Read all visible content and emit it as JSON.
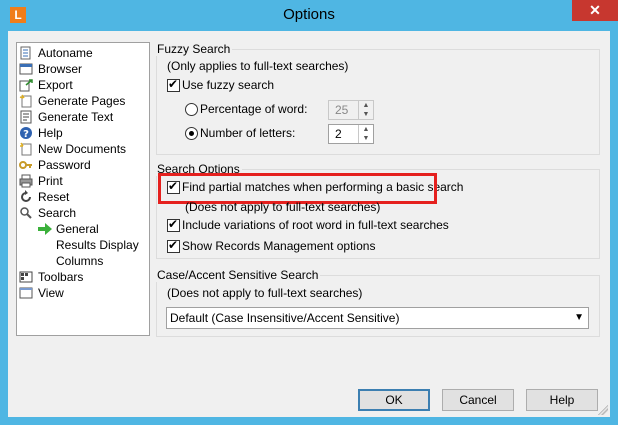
{
  "window": {
    "title": "Options",
    "app_icon_letter": "L",
    "close_glyph": "✕"
  },
  "tree": {
    "items": [
      {
        "label": "Autoname",
        "icon": "autoname-icon"
      },
      {
        "label": "Browser",
        "icon": "browser-icon"
      },
      {
        "label": "Export",
        "icon": "export-icon"
      },
      {
        "label": "Generate Pages",
        "icon": "generate-pages-icon"
      },
      {
        "label": "Generate Text",
        "icon": "generate-text-icon"
      },
      {
        "label": "Help",
        "icon": "help-icon"
      },
      {
        "label": "New Documents",
        "icon": "new-documents-icon"
      },
      {
        "label": "Password",
        "icon": "password-icon"
      },
      {
        "label": "Print",
        "icon": "print-icon"
      },
      {
        "label": "Reset",
        "icon": "reset-icon"
      },
      {
        "label": "Search",
        "icon": "search-icon"
      },
      {
        "label": "General",
        "icon": "green-arrow-icon",
        "selected": true
      },
      {
        "label": "Results Display"
      },
      {
        "label": "Columns"
      },
      {
        "label": "Toolbars",
        "icon": "toolbars-icon"
      },
      {
        "label": "View",
        "icon": "view-icon"
      }
    ]
  },
  "fuzzy": {
    "group_label": "Fuzzy Search",
    "note": "(Only applies to full-text searches)",
    "use_fuzzy": {
      "label": "Use fuzzy search",
      "checked": true
    },
    "percentage": {
      "label": "Percentage of word:",
      "value": "25",
      "selected": false,
      "disabled": true
    },
    "letters": {
      "label": "Number of letters:",
      "value": "2",
      "selected": true
    }
  },
  "search_options": {
    "group_label": "Search Options",
    "partial": {
      "label": "Find partial matches when performing a basic search",
      "checked": true
    },
    "partial_note": "(Does not apply to full-text searches)",
    "variations": {
      "label": "Include variations of root word in full-text searches",
      "checked": true
    },
    "records": {
      "label": "Show Records Management options",
      "checked": true
    },
    "highlight_color": "#e5201e"
  },
  "case": {
    "group_label": "Case/Accent Sensitive Search",
    "note": "(Does not apply to full-text searches)",
    "selected": "Default (Case Insensitive/Accent Sensitive)"
  },
  "buttons": {
    "ok": "OK",
    "cancel": "Cancel",
    "help": "Help"
  },
  "colors": {
    "titlebar": "#4fb6e3",
    "close": "#c7372f",
    "app_icon": "#f07d1a"
  }
}
